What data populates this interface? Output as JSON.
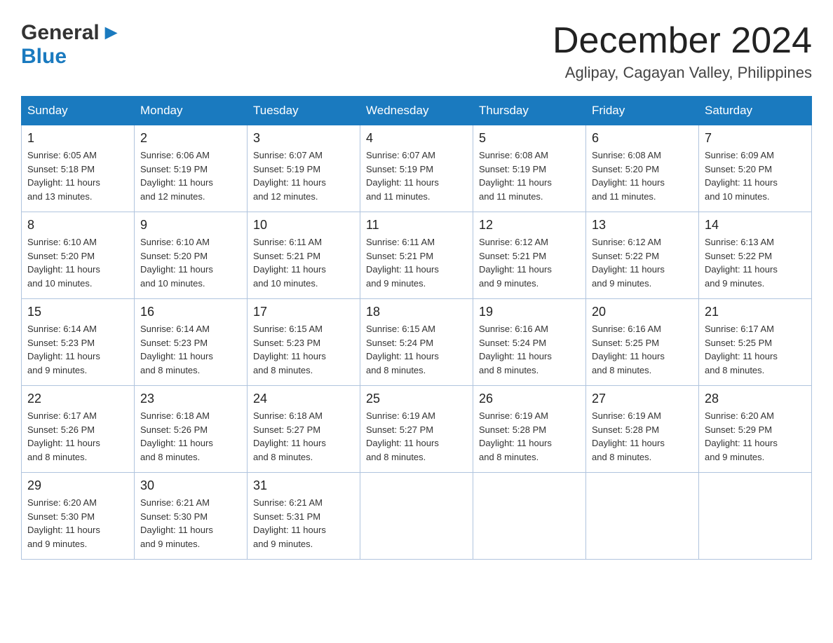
{
  "header": {
    "logo_general": "General",
    "logo_blue": "Blue",
    "month_title": "December 2024",
    "location": "Aglipay, Cagayan Valley, Philippines"
  },
  "weekdays": [
    "Sunday",
    "Monday",
    "Tuesday",
    "Wednesday",
    "Thursday",
    "Friday",
    "Saturday"
  ],
  "weeks": [
    [
      {
        "day": "1",
        "sunrise": "6:05 AM",
        "sunset": "5:18 PM",
        "daylight": "11 hours and 13 minutes."
      },
      {
        "day": "2",
        "sunrise": "6:06 AM",
        "sunset": "5:19 PM",
        "daylight": "11 hours and 12 minutes."
      },
      {
        "day": "3",
        "sunrise": "6:07 AM",
        "sunset": "5:19 PM",
        "daylight": "11 hours and 12 minutes."
      },
      {
        "day": "4",
        "sunrise": "6:07 AM",
        "sunset": "5:19 PM",
        "daylight": "11 hours and 11 minutes."
      },
      {
        "day": "5",
        "sunrise": "6:08 AM",
        "sunset": "5:19 PM",
        "daylight": "11 hours and 11 minutes."
      },
      {
        "day": "6",
        "sunrise": "6:08 AM",
        "sunset": "5:20 PM",
        "daylight": "11 hours and 11 minutes."
      },
      {
        "day": "7",
        "sunrise": "6:09 AM",
        "sunset": "5:20 PM",
        "daylight": "11 hours and 10 minutes."
      }
    ],
    [
      {
        "day": "8",
        "sunrise": "6:10 AM",
        "sunset": "5:20 PM",
        "daylight": "11 hours and 10 minutes."
      },
      {
        "day": "9",
        "sunrise": "6:10 AM",
        "sunset": "5:20 PM",
        "daylight": "11 hours and 10 minutes."
      },
      {
        "day": "10",
        "sunrise": "6:11 AM",
        "sunset": "5:21 PM",
        "daylight": "11 hours and 10 minutes."
      },
      {
        "day": "11",
        "sunrise": "6:11 AM",
        "sunset": "5:21 PM",
        "daylight": "11 hours and 9 minutes."
      },
      {
        "day": "12",
        "sunrise": "6:12 AM",
        "sunset": "5:21 PM",
        "daylight": "11 hours and 9 minutes."
      },
      {
        "day": "13",
        "sunrise": "6:12 AM",
        "sunset": "5:22 PM",
        "daylight": "11 hours and 9 minutes."
      },
      {
        "day": "14",
        "sunrise": "6:13 AM",
        "sunset": "5:22 PM",
        "daylight": "11 hours and 9 minutes."
      }
    ],
    [
      {
        "day": "15",
        "sunrise": "6:14 AM",
        "sunset": "5:23 PM",
        "daylight": "11 hours and 9 minutes."
      },
      {
        "day": "16",
        "sunrise": "6:14 AM",
        "sunset": "5:23 PM",
        "daylight": "11 hours and 8 minutes."
      },
      {
        "day": "17",
        "sunrise": "6:15 AM",
        "sunset": "5:23 PM",
        "daylight": "11 hours and 8 minutes."
      },
      {
        "day": "18",
        "sunrise": "6:15 AM",
        "sunset": "5:24 PM",
        "daylight": "11 hours and 8 minutes."
      },
      {
        "day": "19",
        "sunrise": "6:16 AM",
        "sunset": "5:24 PM",
        "daylight": "11 hours and 8 minutes."
      },
      {
        "day": "20",
        "sunrise": "6:16 AM",
        "sunset": "5:25 PM",
        "daylight": "11 hours and 8 minutes."
      },
      {
        "day": "21",
        "sunrise": "6:17 AM",
        "sunset": "5:25 PM",
        "daylight": "11 hours and 8 minutes."
      }
    ],
    [
      {
        "day": "22",
        "sunrise": "6:17 AM",
        "sunset": "5:26 PM",
        "daylight": "11 hours and 8 minutes."
      },
      {
        "day": "23",
        "sunrise": "6:18 AM",
        "sunset": "5:26 PM",
        "daylight": "11 hours and 8 minutes."
      },
      {
        "day": "24",
        "sunrise": "6:18 AM",
        "sunset": "5:27 PM",
        "daylight": "11 hours and 8 minutes."
      },
      {
        "day": "25",
        "sunrise": "6:19 AM",
        "sunset": "5:27 PM",
        "daylight": "11 hours and 8 minutes."
      },
      {
        "day": "26",
        "sunrise": "6:19 AM",
        "sunset": "5:28 PM",
        "daylight": "11 hours and 8 minutes."
      },
      {
        "day": "27",
        "sunrise": "6:19 AM",
        "sunset": "5:28 PM",
        "daylight": "11 hours and 8 minutes."
      },
      {
        "day": "28",
        "sunrise": "6:20 AM",
        "sunset": "5:29 PM",
        "daylight": "11 hours and 9 minutes."
      }
    ],
    [
      {
        "day": "29",
        "sunrise": "6:20 AM",
        "sunset": "5:30 PM",
        "daylight": "11 hours and 9 minutes."
      },
      {
        "day": "30",
        "sunrise": "6:21 AM",
        "sunset": "5:30 PM",
        "daylight": "11 hours and 9 minutes."
      },
      {
        "day": "31",
        "sunrise": "6:21 AM",
        "sunset": "5:31 PM",
        "daylight": "11 hours and 9 minutes."
      },
      null,
      null,
      null,
      null
    ]
  ],
  "labels": {
    "sunrise": "Sunrise:",
    "sunset": "Sunset:",
    "daylight": "Daylight:"
  }
}
